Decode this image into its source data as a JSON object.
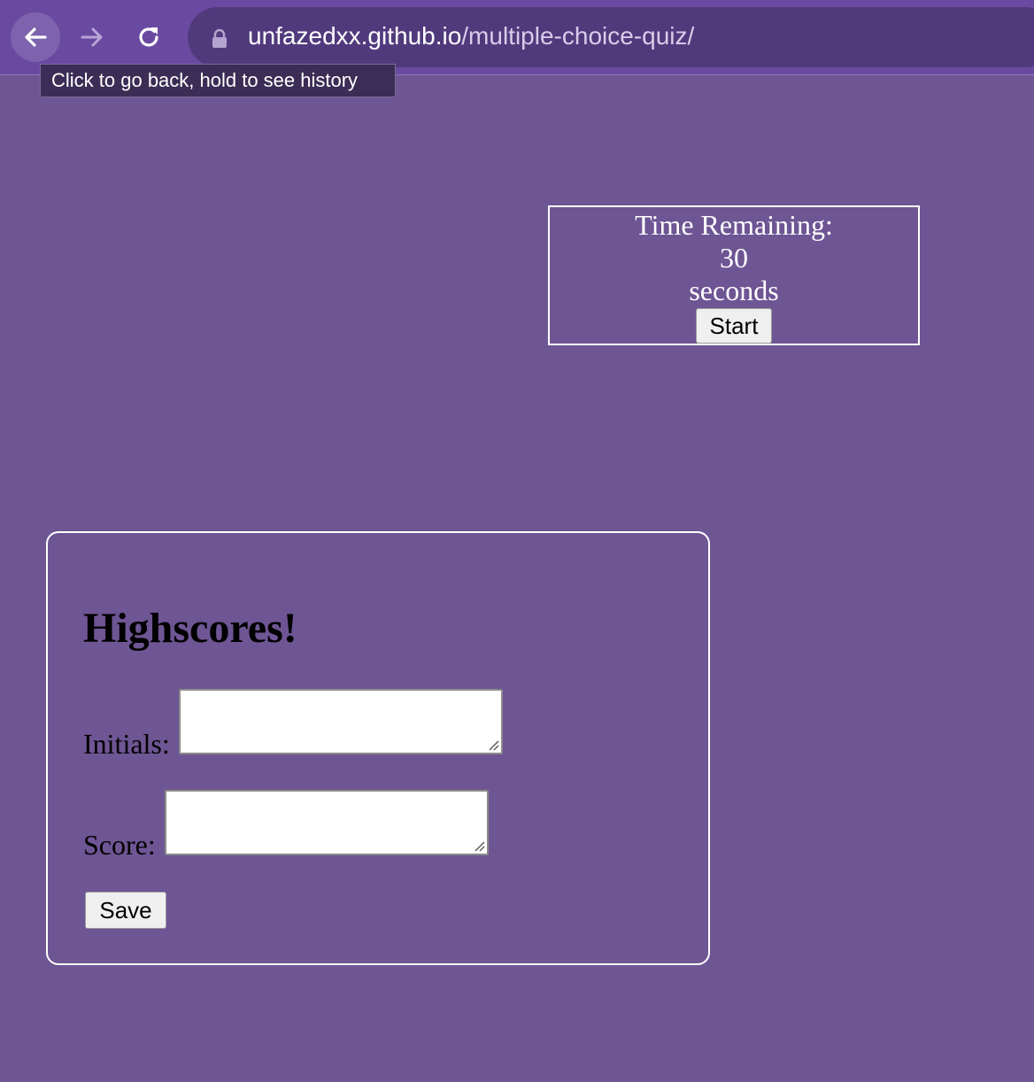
{
  "browser": {
    "url_host": "unfazedxx.github.io",
    "url_path": "/multiple-choice-quiz/",
    "tooltip": "Click to go back, hold to see history",
    "icons": [
      "back-arrow-icon",
      "forward-arrow-icon",
      "reload-icon",
      "lock-icon"
    ]
  },
  "timer": {
    "label": "Time Remaining:",
    "value": "30",
    "unit": "seconds",
    "start_label": "Start"
  },
  "highscores": {
    "title": "Highscores!",
    "initials_label": "Initials:",
    "initials_value": "",
    "score_label": "Score:",
    "score_value": "",
    "save_label": "Save"
  }
}
